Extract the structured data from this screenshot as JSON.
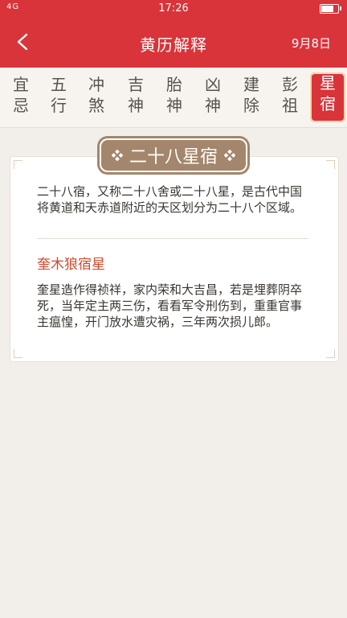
{
  "status_bar": {
    "signal_left": "4G",
    "time": "17:26"
  },
  "nav": {
    "title": "黄历解释",
    "date": "9月8日"
  },
  "tabs": [
    {
      "line1": "宜",
      "line2": "忌"
    },
    {
      "line1": "五",
      "line2": "行"
    },
    {
      "line1": "冲",
      "line2": "煞"
    },
    {
      "line1": "吉",
      "line2": "神"
    },
    {
      "line1": "胎",
      "line2": "神"
    },
    {
      "line1": "凶",
      "line2": "神"
    },
    {
      "line1": "建",
      "line2": "除"
    },
    {
      "line1": "彭",
      "line2": "祖"
    },
    {
      "line1": "星",
      "line2": "宿"
    }
  ],
  "active_tab": 8,
  "section": {
    "title": "二十八星宿",
    "intro": "二十八宿，又称二十八舍或二十八星，是古代中国将黄道和天赤道附近的天区划分为二十八个区域。",
    "subtitle": "奎木狼宿星",
    "body": "奎星造作得祯祥，家内荣和大吉昌，若是埋葬阴卒死，当年定主两三伤，看看军令刑伤到，重重官事主瘟惶，开门放水遭灾祸，三年两次损儿郎。"
  },
  "colors": {
    "brand_red": "#d9343a",
    "badge_brown": "#a3866b",
    "subtitle_orange": "#d04a2f"
  }
}
